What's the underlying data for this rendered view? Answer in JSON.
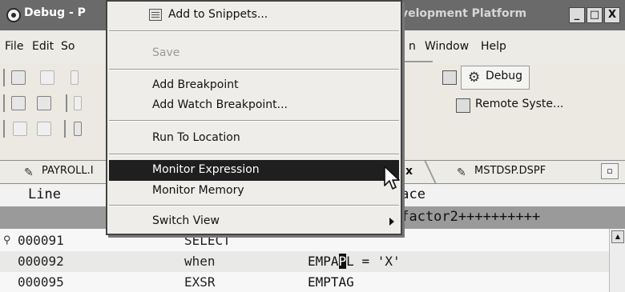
{
  "window": {
    "title_left": "Debug - P",
    "title_right": "velopment Platform",
    "minimize": "_",
    "maximize": "□",
    "close": "X"
  },
  "menubar": {
    "items": [
      "File",
      "Edit",
      "So",
      "n",
      "Window",
      "Help"
    ]
  },
  "perspectives": {
    "debug_label": "Debug",
    "remote_label": "Remote Syste..."
  },
  "tabs": {
    "payroll": "PAYROLL.I",
    "active_suffix": "...",
    "close": "x",
    "mstdsp": "MSTDSP.DSPF",
    "maximize": "▫"
  },
  "editor": {
    "header_line": "Line",
    "header_place": "lace",
    "ruler": "-factor2++++++++++",
    "rows": [
      {
        "num": "000091",
        "op": "SELECT",
        "arg": "",
        "breakpoint_icon": "key-icon"
      },
      {
        "num": "000092",
        "op": "when",
        "arg_before": "EMPA",
        "arg_cursor": "P",
        "arg_after": "L = 'X'"
      },
      {
        "num": "000095",
        "op": "EXSR",
        "arg": "EMPTAG"
      }
    ]
  },
  "context_menu": {
    "items": [
      {
        "label": "Add to Snippets...",
        "enabled": true,
        "icon": "snippet-icon"
      },
      {
        "label": "Save",
        "enabled": false
      },
      {
        "label": "Add Breakpoint",
        "enabled": true
      },
      {
        "label": "Add Watch Breakpoint...",
        "enabled": true
      },
      {
        "label": "Run To Location",
        "enabled": true
      },
      {
        "label": "Monitor Expression",
        "enabled": true,
        "selected": true
      },
      {
        "label": "Monitor Memory",
        "enabled": true
      },
      {
        "label": "Switch View",
        "enabled": true,
        "submenu": true
      }
    ]
  },
  "colors": {
    "titlebar": "#6a6a6a",
    "menu_selected": "#1f1f1f",
    "ruler_bg": "#9a9a9a"
  }
}
